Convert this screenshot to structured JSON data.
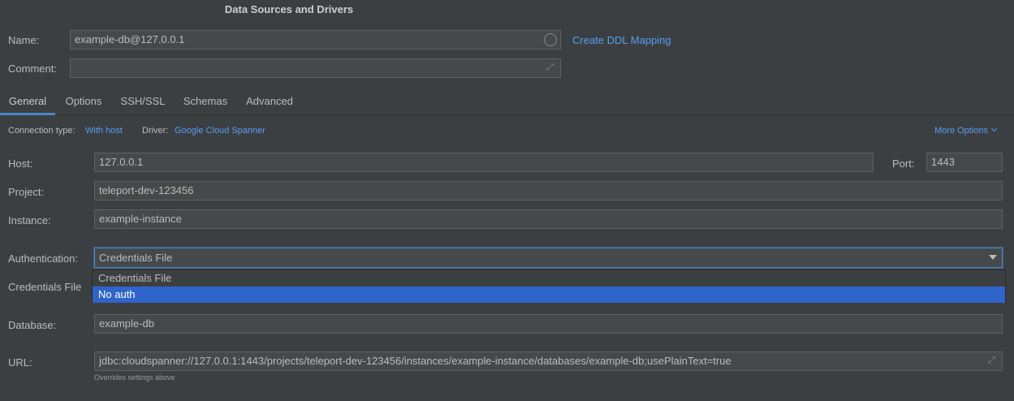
{
  "dialog": {
    "title": "Data Sources and Drivers"
  },
  "name": {
    "label": "Name:",
    "value": "example-db@127.0.0.1",
    "link": "Create DDL Mapping"
  },
  "comment": {
    "label": "Comment:",
    "value": ""
  },
  "tabs": [
    {
      "label": "General",
      "active": true
    },
    {
      "label": "Options"
    },
    {
      "label": "SSH/SSL"
    },
    {
      "label": "Schemas"
    },
    {
      "label": "Advanced"
    }
  ],
  "connection": {
    "type_label": "Connection type:",
    "type_value": "With host",
    "driver_label": "Driver:",
    "driver_value": "Google Cloud Spanner",
    "more_options": "More Options"
  },
  "host": {
    "label": "Host:",
    "value": "127.0.0.1"
  },
  "port": {
    "label": "Port:",
    "value": "1443"
  },
  "project": {
    "label": "Project:",
    "value": "teleport-dev-123456"
  },
  "instance": {
    "label": "Instance:",
    "value": "example-instance"
  },
  "authentication": {
    "label": "Authentication:",
    "selected": "Credentials File",
    "options": [
      "Credentials File",
      "No auth"
    ],
    "highlighted": "No auth"
  },
  "credentials_file": {
    "label": "Credentials File"
  },
  "database": {
    "label": "Database:",
    "value": "example-db"
  },
  "url": {
    "label": "URL:",
    "value": "jdbc:cloudspanner://127.0.0.1:1443/projects/teleport-dev-123456/instances/example-instance/databases/example-db;usePlainText=true",
    "hint": "Overrides settings above"
  },
  "colors": {
    "accent": "#589df6",
    "selection": "#2f65ca",
    "background": "#3c3f41"
  }
}
